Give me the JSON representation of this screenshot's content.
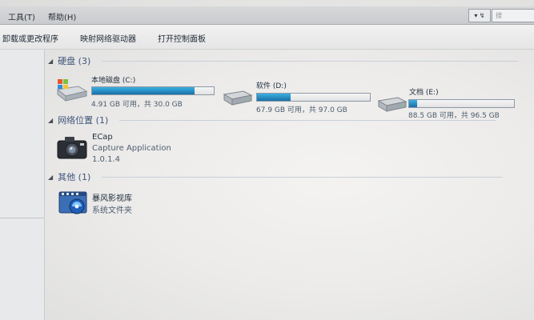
{
  "menubar": {
    "tools": "工具(T)",
    "help": "帮助(H)",
    "nav_glyph": "▾ ↯",
    "search_glyph": "搜"
  },
  "toolbar": {
    "uninstall": "卸载或更改程序",
    "map_drive": "映射网络驱动器",
    "control_panel": "打开控制面板"
  },
  "groups": {
    "hard_disks": "硬盘 (3)",
    "network": "网络位置 (1)",
    "other": "其他 (1)"
  },
  "drives": [
    {
      "name": "本地磁盘 (C:)",
      "info": "4.91 GB 可用，共 30.0 GB",
      "used_fraction": 0.84
    },
    {
      "name": "软件 (D:)",
      "info": "67.9 GB 可用，共 97.0 GB",
      "used_fraction": 0.3
    },
    {
      "name": "文档 (E:)",
      "info": "88.5 GB 可用，共 96.5 GB",
      "used_fraction": 0.08
    }
  ],
  "network_item": {
    "name": "ECap",
    "desc": "Capture Application",
    "version": "1.0.1.4"
  },
  "other_item": {
    "name": "暴风影视库",
    "desc": "系统文件夹"
  },
  "colors": {
    "bar_fill": "#1a6fa8",
    "group_header": "#3e5578"
  }
}
